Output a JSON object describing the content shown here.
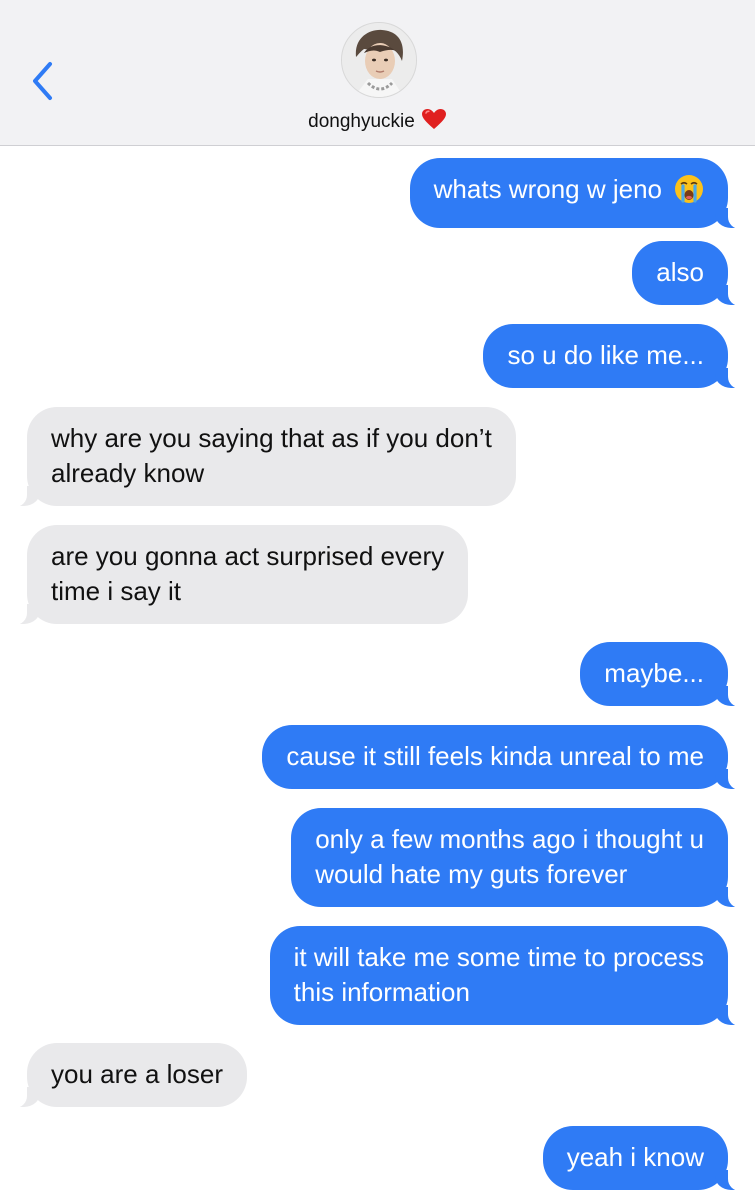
{
  "header": {
    "contact_name": "donghyuckie",
    "name_suffix_icon": "red-heart-icon",
    "back_icon": "chevron-left-icon",
    "accent": "#2f7bf5"
  },
  "messages": [
    {
      "sender": "me",
      "lines": [
        "whats wrong w jeno"
      ],
      "emoji": "loudly-crying-face"
    },
    {
      "sender": "me",
      "lines": [
        "also"
      ]
    },
    {
      "sender": "me",
      "lines": [
        "so u do like me..."
      ]
    },
    {
      "sender": "them",
      "lines": [
        "why are you saying that as if you don’t",
        "already know"
      ]
    },
    {
      "sender": "them",
      "lines": [
        "are you gonna act surprised every",
        "time i say it"
      ]
    },
    {
      "sender": "me",
      "lines": [
        "maybe..."
      ]
    },
    {
      "sender": "me",
      "lines": [
        "cause it still feels kinda unreal to me"
      ]
    },
    {
      "sender": "me",
      "lines": [
        "only a few months ago i thought u",
        "would hate my guts forever"
      ]
    },
    {
      "sender": "me",
      "lines": [
        "it will take me some time to process",
        "this information"
      ]
    },
    {
      "sender": "them",
      "lines": [
        "you are a loser"
      ]
    },
    {
      "sender": "me",
      "lines": [
        "yeah i know"
      ]
    }
  ],
  "colors": {
    "sent_bubble": "#2f7bf5",
    "received_bubble": "#e9e9eb",
    "header_bg": "#f2f2f4"
  }
}
